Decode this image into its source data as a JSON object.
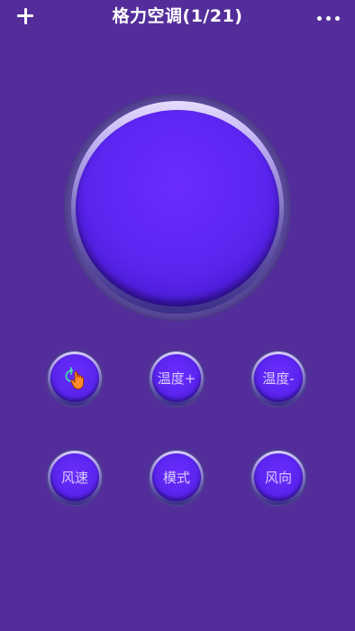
{
  "header": {
    "title": "格力空调(1/21)",
    "add_icon": "plus-icon",
    "more_icon": "more-dots-icon"
  },
  "power_button": {
    "icon": "touch-power-icon"
  },
  "row1": {
    "temp_up_label": "温度+",
    "temp_down_label": "温度-"
  },
  "row2": {
    "fan_speed_label": "风速",
    "mode_label": "模式",
    "direction_label": "风向"
  },
  "colors": {
    "background": "#532e9a",
    "button_face": "#5b25f0",
    "label_text": "#d8ccff",
    "icon_accent": "#3cf0a0"
  }
}
